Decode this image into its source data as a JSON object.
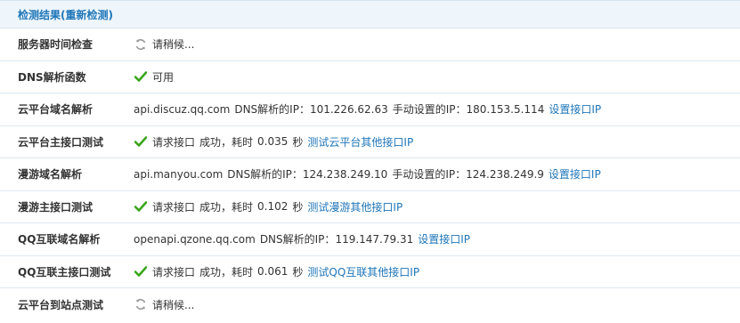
{
  "header": {
    "title": "检测结果(重新检测)"
  },
  "colors": {
    "accent": "#1e76b9",
    "header_bg": "#eef5fb",
    "check_green": "#3aa51b",
    "spinner_gray": "#9a9a9a"
  },
  "rows": [
    {
      "label": "服务器时间检查",
      "icon": "spinner-icon",
      "text": "请稍候..."
    },
    {
      "label": "DNS解析函数",
      "icon": "check-icon",
      "text": "可用"
    },
    {
      "label": "云平台域名解析",
      "domain": "api.discuz.qq.com",
      "dns_label": "DNS解析的IP：",
      "dns_ip": "101.226.62.63",
      "manual_label": "手动设置的IP：",
      "manual_ip": "180.153.5.114",
      "link": "设置接口IP"
    },
    {
      "label": "云平台主接口测试",
      "icon": "check-icon",
      "request": "请求接口",
      "result": "成功，耗时",
      "time": "0.035",
      "unit": "秒",
      "link": "测试云平台其他接口IP"
    },
    {
      "label": "漫游域名解析",
      "domain": "api.manyou.com",
      "dns_label": "DNS解析的IP：",
      "dns_ip": "124.238.249.10",
      "manual_label": "手动设置的IP：",
      "manual_ip": "124.238.249.9",
      "link": "设置接口IP"
    },
    {
      "label": "漫游主接口测试",
      "icon": "check-icon",
      "request": "请求接口",
      "result": "成功，耗时",
      "time": "0.102",
      "unit": "秒",
      "link": "测试漫游其他接口IP"
    },
    {
      "label": "QQ互联域名解析",
      "domain": "openapi.qzone.qq.com",
      "dns_label": "DNS解析的IP：",
      "dns_ip": "119.147.79.31",
      "link": "设置接口IP"
    },
    {
      "label": "QQ互联主接口测试",
      "icon": "check-icon",
      "request": "请求接口",
      "result": "成功，耗时",
      "time": "0.061",
      "unit": "秒",
      "link": "测试QQ互联其他接口IP"
    },
    {
      "label": "云平台到站点测试",
      "icon": "spinner-icon",
      "text": "请稍候..."
    }
  ]
}
